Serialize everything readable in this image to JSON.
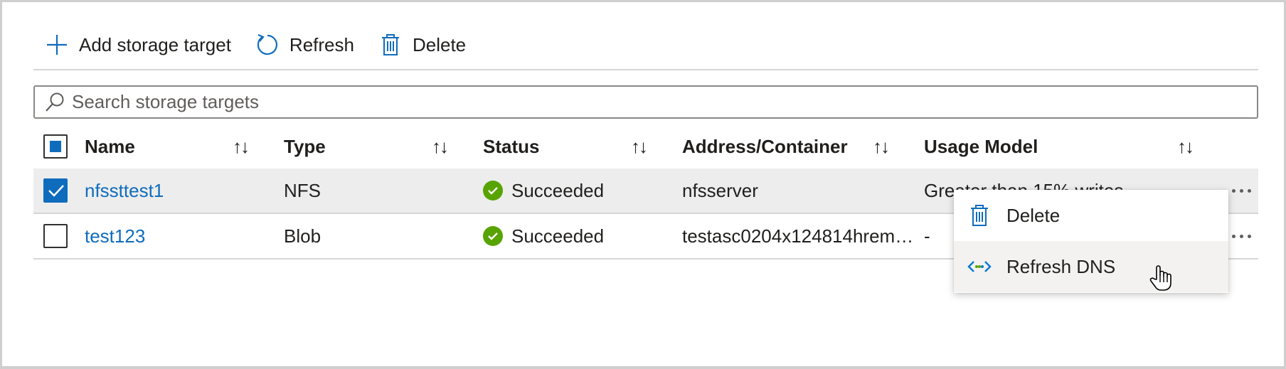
{
  "toolbar": {
    "add_label": "Add storage target",
    "refresh_label": "Refresh",
    "delete_label": "Delete",
    "icons": [
      "plus-icon",
      "refresh-icon",
      "trash-icon"
    ]
  },
  "search": {
    "placeholder": "Search storage targets",
    "value": ""
  },
  "table": {
    "columns": [
      "Name",
      "Type",
      "Status",
      "Address/Container",
      "Usage Model"
    ],
    "rows": [
      {
        "name": "nfssttest1",
        "type": "NFS",
        "status": "Succeeded",
        "address": "nfsserver",
        "usage": "Greater than 15% writes",
        "selected": true
      },
      {
        "name": "test123",
        "type": "Blob",
        "status": "Succeeded",
        "address": "testasc0204x124814hrem…",
        "usage": "-",
        "selected": false
      }
    ]
  },
  "context_menu": {
    "items": [
      {
        "label": "Delete",
        "icon": "trash-icon"
      },
      {
        "label": "Refresh DNS",
        "icon": "dns-refresh-icon"
      }
    ]
  },
  "colors": {
    "accent": "#0f6cbd",
    "success": "#57a300",
    "selected_row": "#ededed",
    "dns_icon_blue": "#0078d4",
    "dns_icon_green": "#57a300"
  }
}
